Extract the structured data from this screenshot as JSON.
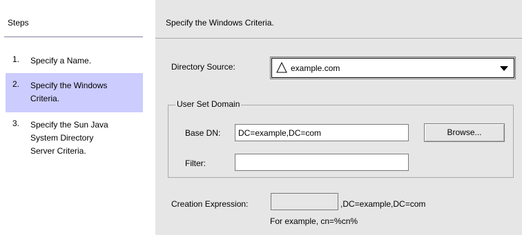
{
  "steps": {
    "title": "Steps",
    "items": [
      {
        "num": "1.",
        "label": "Specify a Name."
      },
      {
        "num": "2.",
        "label": "Specify the Windows Criteria."
      },
      {
        "num": "3.",
        "label": "Specify the Sun Java System Directory Server Criteria."
      }
    ],
    "highlight_color": "#ccccff"
  },
  "content": {
    "header": "Specify the Windows Criteria.",
    "directory_source": {
      "label": "Directory Source:",
      "selected_value": "example.com",
      "icon": "triangle-icon"
    },
    "user_set_domain": {
      "legend": "User Set Domain",
      "base_dn_label": "Base DN:",
      "base_dn_value": "DC=example,DC=com",
      "browse_label": "Browse...",
      "filter_label": "Filter:",
      "filter_value": ""
    },
    "creation_expression": {
      "label": "Creation Expression:",
      "value": "",
      "suffix": ",DC=example,DC=com",
      "example": "For example, cn=%cn%"
    }
  },
  "colors": {
    "panel_background": "#e6e6e6",
    "border": "#a8a8a8"
  }
}
